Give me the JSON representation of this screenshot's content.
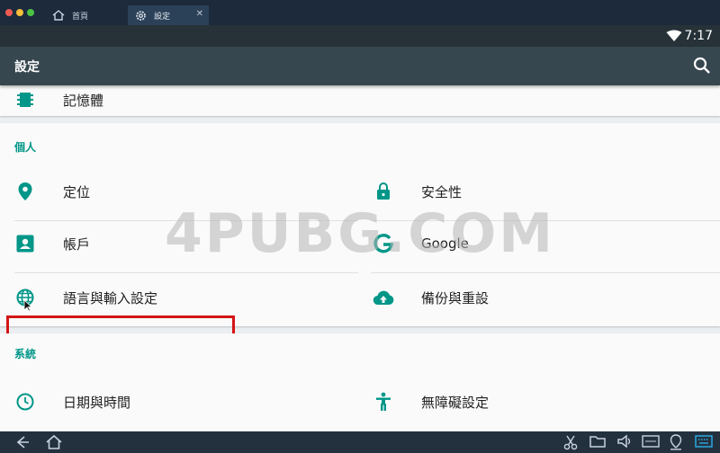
{
  "host": {
    "tabs": [
      {
        "label": "首頁",
        "icon": "home-icon"
      },
      {
        "label": "設定",
        "icon": "gear-icon",
        "close": "✕"
      }
    ]
  },
  "status": {
    "time": "7:17"
  },
  "toolbar": {
    "title": "設定"
  },
  "storage_item": {
    "label": "記憶體"
  },
  "personal": {
    "header": "個人",
    "items": [
      {
        "label": "定位",
        "icon": "location-icon"
      },
      {
        "label": "安全性",
        "icon": "lock-icon"
      },
      {
        "label": "帳戶",
        "icon": "account-icon"
      },
      {
        "label": "Google",
        "icon": "google-icon"
      },
      {
        "label": "語言與輸入設定",
        "icon": "globe-icon"
      },
      {
        "label": "備份與重設",
        "icon": "cloud-upload-icon"
      }
    ]
  },
  "system": {
    "header": "系統",
    "items": [
      {
        "label": "日期與時間",
        "icon": "clock-icon"
      },
      {
        "label": "無障礙設定",
        "icon": "accessibility-icon"
      }
    ]
  },
  "watermark": "4PUBG.COM",
  "colors": {
    "accent": "#009688",
    "toolbar": "#37474f",
    "highlight": "#d31515"
  }
}
